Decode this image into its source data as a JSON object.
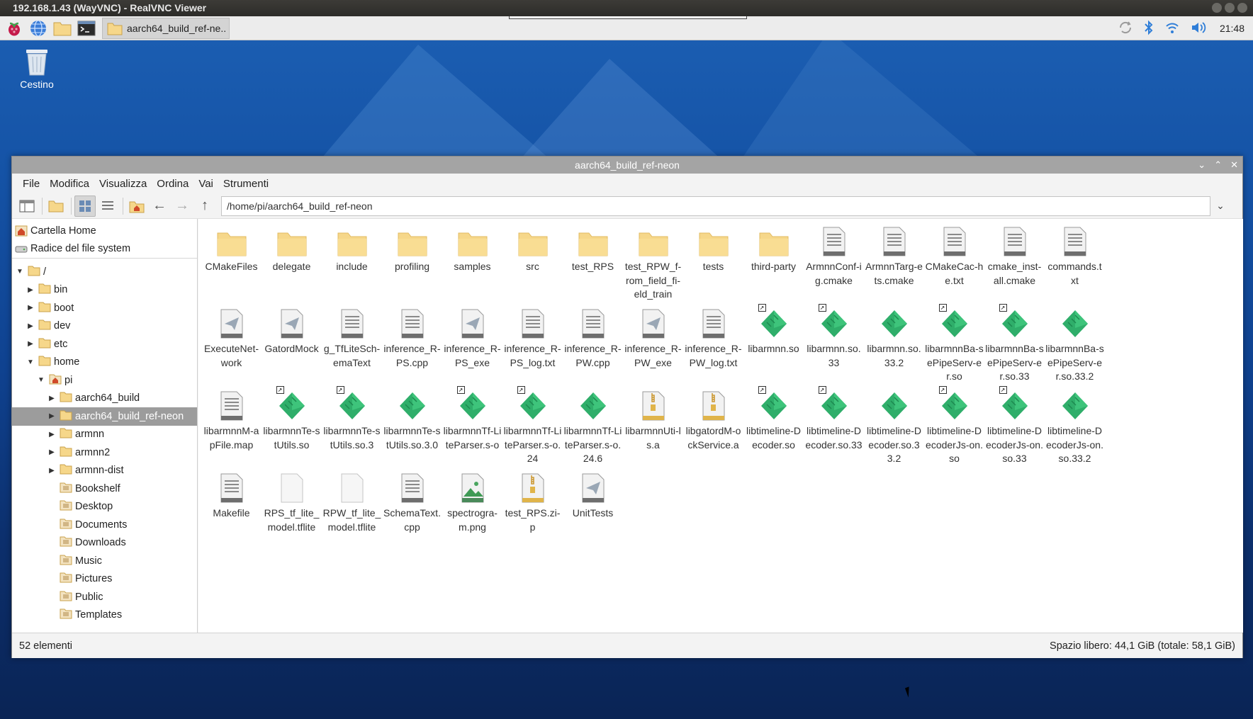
{
  "vnc": {
    "title": "192.168.1.43 (WayVNC) - RealVNC Viewer"
  },
  "taskbar": {
    "launchers": [
      {
        "name": "raspberry-menu-icon"
      },
      {
        "name": "browser-icon"
      },
      {
        "name": "file-manager-icon"
      },
      {
        "name": "terminal-icon"
      }
    ],
    "task_label": "aarch64_build_ref-ne..",
    "clock": "21:48"
  },
  "desktop": {
    "trash_label": "Cestino"
  },
  "window": {
    "title": "aarch64_build_ref-neon",
    "menu": [
      "File",
      "Modifica",
      "Visualizza",
      "Ordina",
      "Vai",
      "Strumenti"
    ],
    "path": "/home/pi/aarch64_build_ref-neon"
  },
  "places": [
    {
      "label": "Cartella Home",
      "icon": "home-icon"
    },
    {
      "label": "Radice del file system",
      "icon": "drive-icon"
    }
  ],
  "tree": [
    {
      "label": "/",
      "level": 0,
      "expanded": true
    },
    {
      "label": "bin",
      "level": 1,
      "expanded": false
    },
    {
      "label": "boot",
      "level": 1,
      "expanded": false
    },
    {
      "label": "dev",
      "level": 1,
      "expanded": false
    },
    {
      "label": "etc",
      "level": 1,
      "expanded": false
    },
    {
      "label": "home",
      "level": 1,
      "expanded": true
    },
    {
      "label": "pi",
      "level": 2,
      "expanded": true,
      "home": true
    },
    {
      "label": "aarch64_build",
      "level": 3,
      "expanded": false
    },
    {
      "label": "aarch64_build_ref-neon",
      "level": 3,
      "expanded": false,
      "selected": true
    },
    {
      "label": "armnn",
      "level": 3,
      "expanded": false
    },
    {
      "label": "armnn2",
      "level": 3,
      "expanded": false
    },
    {
      "label": "armnn-dist",
      "level": 3,
      "expanded": false
    },
    {
      "label": "Bookshelf",
      "level": 3,
      "leaf": true
    },
    {
      "label": "Desktop",
      "level": 3,
      "leaf": true
    },
    {
      "label": "Documents",
      "level": 3,
      "leaf": true
    },
    {
      "label": "Downloads",
      "level": 3,
      "leaf": true
    },
    {
      "label": "Music",
      "level": 3,
      "leaf": true
    },
    {
      "label": "Pictures",
      "level": 3,
      "leaf": true
    },
    {
      "label": "Public",
      "level": 3,
      "leaf": true
    },
    {
      "label": "Templates",
      "level": 3,
      "leaf": true
    }
  ],
  "files": [
    {
      "name": "CMakeFiles",
      "type": "folder"
    },
    {
      "name": "delegate",
      "type": "folder"
    },
    {
      "name": "include",
      "type": "folder"
    },
    {
      "name": "profiling",
      "type": "folder"
    },
    {
      "name": "samples",
      "type": "folder"
    },
    {
      "name": "src",
      "type": "folder"
    },
    {
      "name": "test_RPS",
      "type": "folder"
    },
    {
      "name": "test_RPW_f-rom_field_fi-eld_train",
      "type": "folder"
    },
    {
      "name": "tests",
      "type": "folder"
    },
    {
      "name": "third-party",
      "type": "folder"
    },
    {
      "name": "ArmnnConf-ig.cmake",
      "type": "text"
    },
    {
      "name": "ArmnnTarg-ets.cmake",
      "type": "text"
    },
    {
      "name": "CMakeCac-he.txt",
      "type": "text"
    },
    {
      "name": "cmake_inst-all.cmake",
      "type": "text"
    },
    {
      "name": "commands.txt",
      "type": "text"
    },
    {
      "name": "ExecuteNet-work",
      "type": "exec"
    },
    {
      "name": "GatordMock",
      "type": "exec"
    },
    {
      "name": "g_TfLiteSch-emaText",
      "type": "text"
    },
    {
      "name": "inference_R-PS.cpp",
      "type": "text"
    },
    {
      "name": "inference_R-PS_exe",
      "type": "exec"
    },
    {
      "name": "inference_R-PS_log.txt",
      "type": "text"
    },
    {
      "name": "inference_R-PW.cpp",
      "type": "text"
    },
    {
      "name": "inference_R-PW_exe",
      "type": "exec"
    },
    {
      "name": "inference_R-PW_log.txt",
      "type": "text"
    },
    {
      "name": "libarmnn.so",
      "type": "lib",
      "link": true
    },
    {
      "name": "libarmnn.so.33",
      "type": "lib",
      "link": true
    },
    {
      "name": "libarmnn.so.33.2",
      "type": "lib"
    },
    {
      "name": "libarmnnBa-sePipeServ-er.so",
      "type": "lib",
      "link": true
    },
    {
      "name": "libarmnnBa-sePipeServ-er.so.33",
      "type": "lib",
      "link": true
    },
    {
      "name": "libarmnnBa-sePipeServ-er.so.33.2",
      "type": "lib"
    },
    {
      "name": "libarmnnM-apFile.map",
      "type": "text"
    },
    {
      "name": "libarmnnTe-stUtils.so",
      "type": "lib",
      "link": true
    },
    {
      "name": "libarmnnTe-stUtils.so.3",
      "type": "lib",
      "link": true
    },
    {
      "name": "libarmnnTe-stUtils.so.3.0",
      "type": "lib"
    },
    {
      "name": "libarmnnTf-LiteParser.s-o",
      "type": "lib",
      "link": true
    },
    {
      "name": "libarmnnTf-LiteParser.s-o.24",
      "type": "lib",
      "link": true
    },
    {
      "name": "libarmnnTf-LiteParser.s-o.24.6",
      "type": "lib"
    },
    {
      "name": "libarmnnUti-ls.a",
      "type": "archive"
    },
    {
      "name": "libgatordM-ockService.a",
      "type": "archive"
    },
    {
      "name": "libtimeline-Decoder.so",
      "type": "lib",
      "link": true
    },
    {
      "name": "libtimeline-Decoder.so.33",
      "type": "lib",
      "link": true
    },
    {
      "name": "libtimeline-Decoder.so.33.2",
      "type": "lib"
    },
    {
      "name": "libtimeline-DecoderJs-on.so",
      "type": "lib",
      "link": true
    },
    {
      "name": "libtimeline-DecoderJs-on.so.33",
      "type": "lib",
      "link": true
    },
    {
      "name": "libtimeline-DecoderJs-on.so.33.2",
      "type": "lib"
    },
    {
      "name": "Makefile",
      "type": "text"
    },
    {
      "name": "RPS_tf_lite_model.tflite",
      "type": "blank"
    },
    {
      "name": "RPW_tf_lite_model.tflite",
      "type": "blank"
    },
    {
      "name": "SchemaText.cpp",
      "type": "text"
    },
    {
      "name": "spectrogra-m.png",
      "type": "image"
    },
    {
      "name": "test_RPS.zi-p",
      "type": "archive"
    },
    {
      "name": "UnitTests",
      "type": "exec"
    }
  ],
  "status": {
    "count": "52 elementi",
    "free": "Spazio libero: 44,1 GiB (totale: 58,1 GiB)"
  },
  "colors": {
    "folder": "#f6d78a",
    "lib": "#2fae6a",
    "selection": "#9c9c9c",
    "titlebar": "#a4a4a4"
  }
}
